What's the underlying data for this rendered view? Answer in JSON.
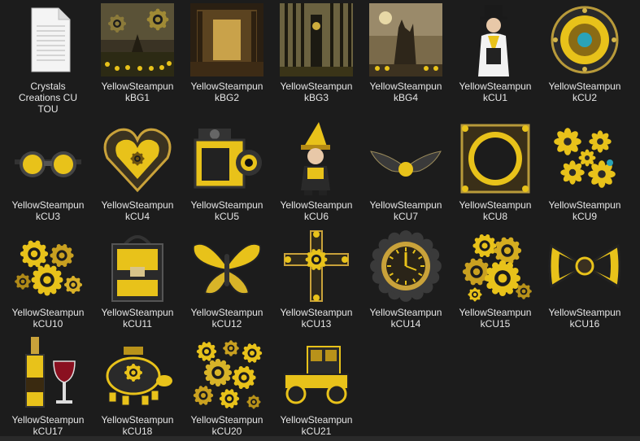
{
  "files": [
    {
      "l1": "Crystals",
      "l2": "Creations CU",
      "l3": "TOU",
      "icon": "text-document-icon",
      "kind": "doc"
    },
    {
      "l1": "YellowSteampun",
      "l2": "kBG1",
      "icon": "steampunk-landscape-thumbnail",
      "kind": "bg1"
    },
    {
      "l1": "YellowSteampun",
      "l2": "kBG2",
      "icon": "steampunk-interior-thumbnail",
      "kind": "bg2"
    },
    {
      "l1": "YellowSteampun",
      "l2": "kBG3",
      "icon": "steampunk-forest-clocktower-thumbnail",
      "kind": "bg3"
    },
    {
      "l1": "YellowSteampun",
      "l2": "kBG4",
      "icon": "steampunk-castle-thumbnail",
      "kind": "bg4"
    },
    {
      "l1": "YellowSteampun",
      "l2": "kCU1",
      "icon": "steampunk-woman-thumbnail",
      "kind": "woman"
    },
    {
      "l1": "YellowSteampun",
      "l2": "kCU2",
      "icon": "steampunk-medallion-thumbnail",
      "kind": "medallion"
    },
    {
      "l1": "YellowSteampun",
      "l2": "kCU3",
      "icon": "steampunk-goggles-thumbnail",
      "kind": "goggles"
    },
    {
      "l1": "YellowSteampun",
      "l2": "kCU4",
      "icon": "steampunk-heart-thumbnail",
      "kind": "heart"
    },
    {
      "l1": "YellowSteampun",
      "l2": "kCU5",
      "icon": "steampunk-camera-thumbnail",
      "kind": "camera"
    },
    {
      "l1": "YellowSteampun",
      "l2": "kCU6",
      "icon": "steampunk-gnome-thumbnail",
      "kind": "gnome"
    },
    {
      "l1": "YellowSteampun",
      "l2": "kCU7",
      "icon": "steampunk-wings-thumbnail",
      "kind": "wings"
    },
    {
      "l1": "YellowSteampun",
      "l2": "kCU8",
      "icon": "steampunk-frame-thumbnail",
      "kind": "frame"
    },
    {
      "l1": "YellowSteampun",
      "l2": "kCU9",
      "icon": "steampunk-flowers-thumbnail",
      "kind": "flowers"
    },
    {
      "l1": "YellowSteampun",
      "l2": "kCU10",
      "icon": "steampunk-gears-cluster-thumbnail",
      "kind": "gears"
    },
    {
      "l1": "YellowSteampun",
      "l2": "kCU11",
      "icon": "steampunk-bag-thumbnail",
      "kind": "bag"
    },
    {
      "l1": "YellowSteampun",
      "l2": "kCU12",
      "icon": "steampunk-butterfly-thumbnail",
      "kind": "butterfly"
    },
    {
      "l1": "YellowSteampun",
      "l2": "kCU13",
      "icon": "steampunk-cross-thumbnail",
      "kind": "cross"
    },
    {
      "l1": "YellowSteampun",
      "l2": "kCU14",
      "icon": "steampunk-clock-thumbnail",
      "kind": "clock"
    },
    {
      "l1": "YellowSteampun",
      "l2": "kCU15",
      "icon": "steampunk-gears-pile-thumbnail",
      "kind": "gears2"
    },
    {
      "l1": "YellowSteampun",
      "l2": "kCU16",
      "icon": "steampunk-bow-thumbnail",
      "kind": "bow"
    },
    {
      "l1": "YellowSteampun",
      "l2": "kCU17",
      "icon": "steampunk-wine-thumbnail",
      "kind": "wine"
    },
    {
      "l1": "YellowSteampun",
      "l2": "kCU18",
      "icon": "steampunk-turtle-thumbnail",
      "kind": "turtle"
    },
    {
      "l1": "YellowSteampun",
      "l2": "kCU20",
      "icon": "steampunk-gears-scatter-thumbnail",
      "kind": "gears3"
    },
    {
      "l1": "YellowSteampun",
      "l2": "kCU21",
      "icon": "steampunk-car-thumbnail",
      "kind": "car"
    }
  ],
  "colors": {
    "background": "#1c1c1c",
    "label": "#e6e6e6",
    "gold": "#e8c21a",
    "dark": "#222222"
  }
}
